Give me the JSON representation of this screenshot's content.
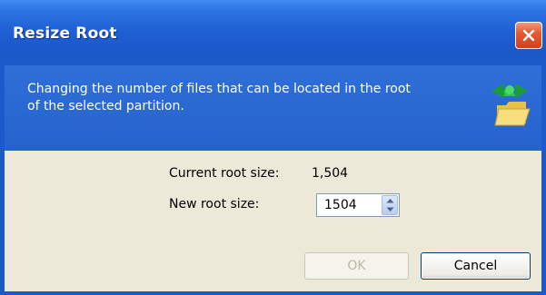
{
  "window": {
    "title": "Resize Root"
  },
  "banner": {
    "line1": "Changing the number of files that can be located in the root",
    "line2": "of the selected partition."
  },
  "form": {
    "current_label": "Current root size:",
    "current_value": "1,504",
    "new_label": "New root size:",
    "new_value": "1504"
  },
  "buttons": {
    "ok": "OK",
    "cancel": "Cancel"
  },
  "icons": {
    "close": "close-icon",
    "banner": "folder-resize-icon",
    "spin_up": "arrow-up-icon",
    "spin_down": "arrow-down-icon"
  },
  "colors": {
    "titlebar": "#1e5fd4",
    "banner": "#2a67d2",
    "dialog_bg": "#ece9d8",
    "close": "#d4411c"
  }
}
